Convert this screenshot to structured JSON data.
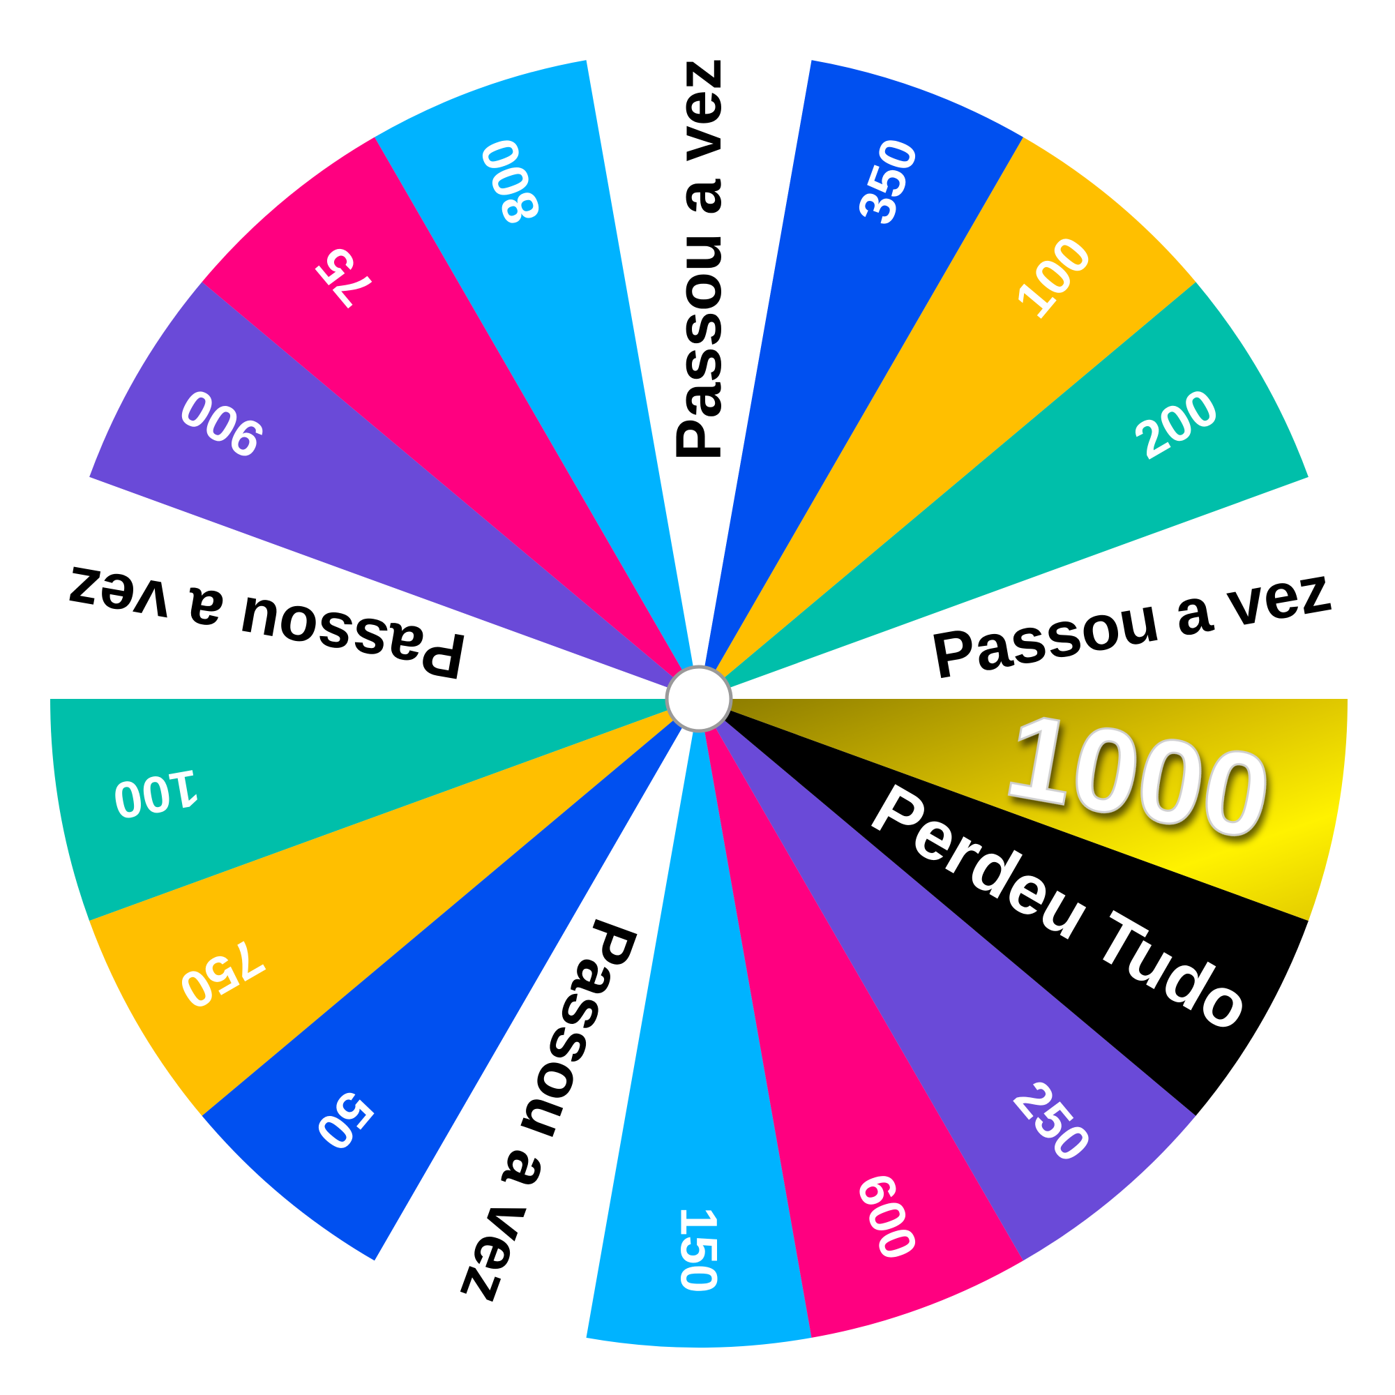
{
  "wheel": {
    "title": "",
    "segments": [
      {
        "label": "Passou a vez",
        "color": "#ffffff",
        "text_color": "#000000",
        "style": "text"
      },
      {
        "label": "200",
        "color": "#00bfaa",
        "text_color": "#ffffff",
        "style": "number"
      },
      {
        "label": "100",
        "color": "#ffbf00",
        "text_color": "#ffffff",
        "style": "number"
      },
      {
        "label": "350",
        "color": "#0050f0",
        "text_color": "#ffffff",
        "style": "number"
      },
      {
        "label": "Passou a vez",
        "color": "#ffffff",
        "text_color": "#000000",
        "style": "text"
      },
      {
        "label": "800",
        "color": "#00b3ff",
        "text_color": "#ffffff",
        "style": "number"
      },
      {
        "label": "75",
        "color": "#ff0080",
        "text_color": "#ffffff",
        "style": "number"
      },
      {
        "label": "900",
        "color": "#6a4ad8",
        "text_color": "#ffffff",
        "style": "number"
      },
      {
        "label": "Passou a vez",
        "color": "#ffffff",
        "text_color": "#000000",
        "style": "text"
      },
      {
        "label": "100",
        "color": "#00bfaa",
        "text_color": "#ffffff",
        "style": "number"
      },
      {
        "label": "750",
        "color": "#ffbf00",
        "text_color": "#ffffff",
        "style": "number"
      },
      {
        "label": "50",
        "color": "#0050f0",
        "text_color": "#ffffff",
        "style": "number"
      },
      {
        "label": "Passou a vez",
        "color": "#ffffff",
        "text_color": "#000000",
        "style": "text"
      },
      {
        "label": "150",
        "color": "#00b3ff",
        "text_color": "#ffffff",
        "style": "number"
      },
      {
        "label": "600",
        "color": "#ff0080",
        "text_color": "#ffffff",
        "style": "number"
      },
      {
        "label": "250",
        "color": "#6a4ad8",
        "text_color": "#ffffff",
        "style": "number"
      },
      {
        "label": "Perdeu Tudo",
        "color": "#000000",
        "text_color": "#ffffff",
        "style": "bankrupt"
      },
      {
        "label": "1000",
        "color": "#e6c800",
        "text_color": "#ffffff",
        "style": "jackpot"
      }
    ],
    "hub_color": "#ffffff"
  }
}
